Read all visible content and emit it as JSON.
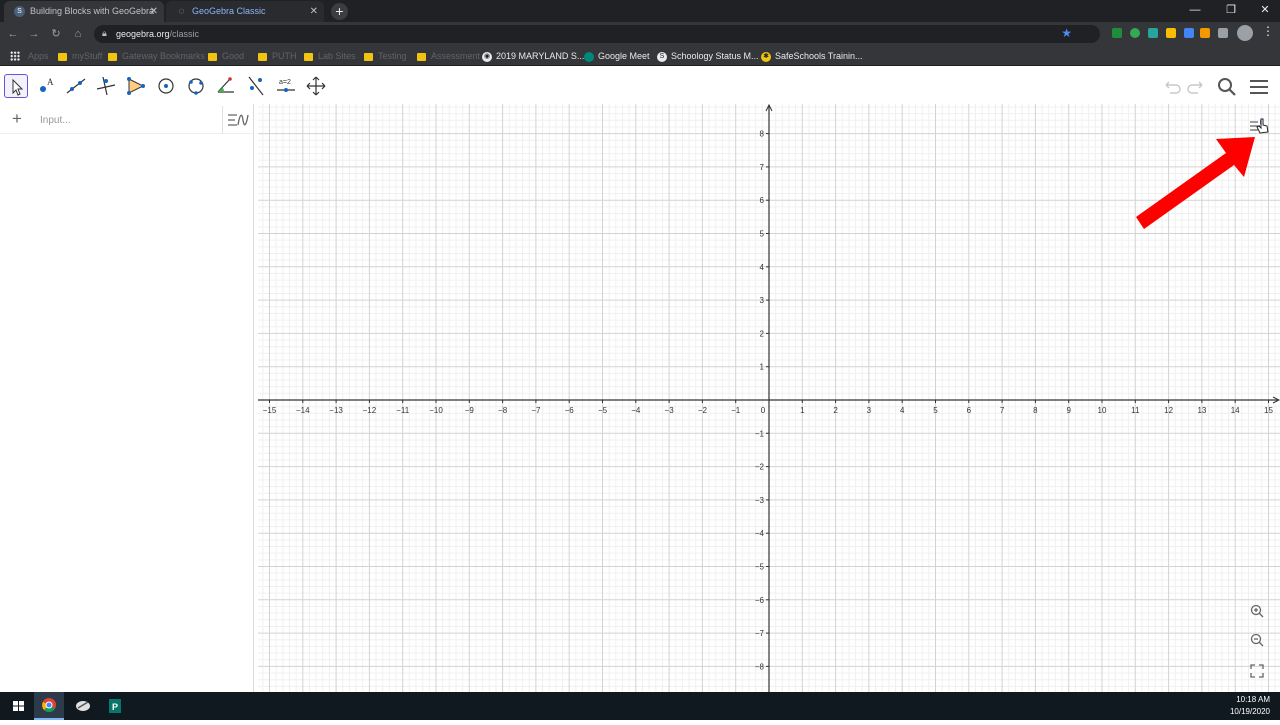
{
  "browser": {
    "tabs": [
      {
        "title": "Building Blocks with GeoGebra",
        "icon": "schoology-icon"
      },
      {
        "title": "GeoGebra Classic",
        "icon": "geogebra-icon"
      }
    ],
    "url_host": "geogebra.org",
    "url_path": "/classic",
    "bookmarks": [
      {
        "label": "Apps",
        "style": "dim"
      },
      {
        "label": "myStuff",
        "style": "dim"
      },
      {
        "label": "Gateway Bookmarks",
        "style": "dim"
      },
      {
        "label": "Good",
        "style": "dim"
      },
      {
        "label": "PUTH",
        "style": "dim"
      },
      {
        "label": "Lab Sites",
        "style": "dim"
      },
      {
        "label": "Testing",
        "style": "dim"
      },
      {
        "label": "Assessment",
        "style": "dim"
      },
      {
        "label": "2019 MARYLAND S...",
        "style": "lit"
      },
      {
        "label": "Google Meet",
        "style": "lit"
      },
      {
        "label": "Schoology Status M...",
        "style": "lit"
      },
      {
        "label": "SafeSchools Trainin...",
        "style": "lit"
      }
    ]
  },
  "geogebra": {
    "input_placeholder": "Input...",
    "tools": [
      "move-tool",
      "point-tool",
      "line-tool",
      "perpendicular-line-tool",
      "polygon-tool",
      "circle-center-point-tool",
      "circle-three-points-tool",
      "angle-tool",
      "reflect-tool",
      "slider-tool",
      "move-graphics-view-tool"
    ],
    "slider_tool_label": "a=2",
    "graph": {
      "x_range": [
        -15,
        15
      ],
      "y_range": [
        -8,
        8
      ],
      "x_tick_labels": [
        "−15",
        "−14",
        "−13",
        "−12",
        "−11",
        "−10",
        "−9",
        "−8",
        "−7",
        "−6",
        "−5",
        "−4",
        "−3",
        "−2",
        "−1",
        "0",
        "1",
        "2",
        "3",
        "4",
        "5",
        "6",
        "7",
        "8",
        "9",
        "10",
        "11",
        "12",
        "13",
        "14",
        "15"
      ],
      "y_tick_labels": [
        "8",
        "7",
        "6",
        "5",
        "4",
        "3",
        "2",
        "1",
        "−1",
        "−2",
        "−3",
        "−4",
        "−5",
        "−6",
        "−7",
        "−8"
      ],
      "grid": true
    }
  },
  "taskbar": {
    "time": "10:18 AM",
    "date": "10/19/2020"
  },
  "annotation": {
    "arrow_color": "#ff0000",
    "points_to": "graphics-style-bar-toggle"
  }
}
